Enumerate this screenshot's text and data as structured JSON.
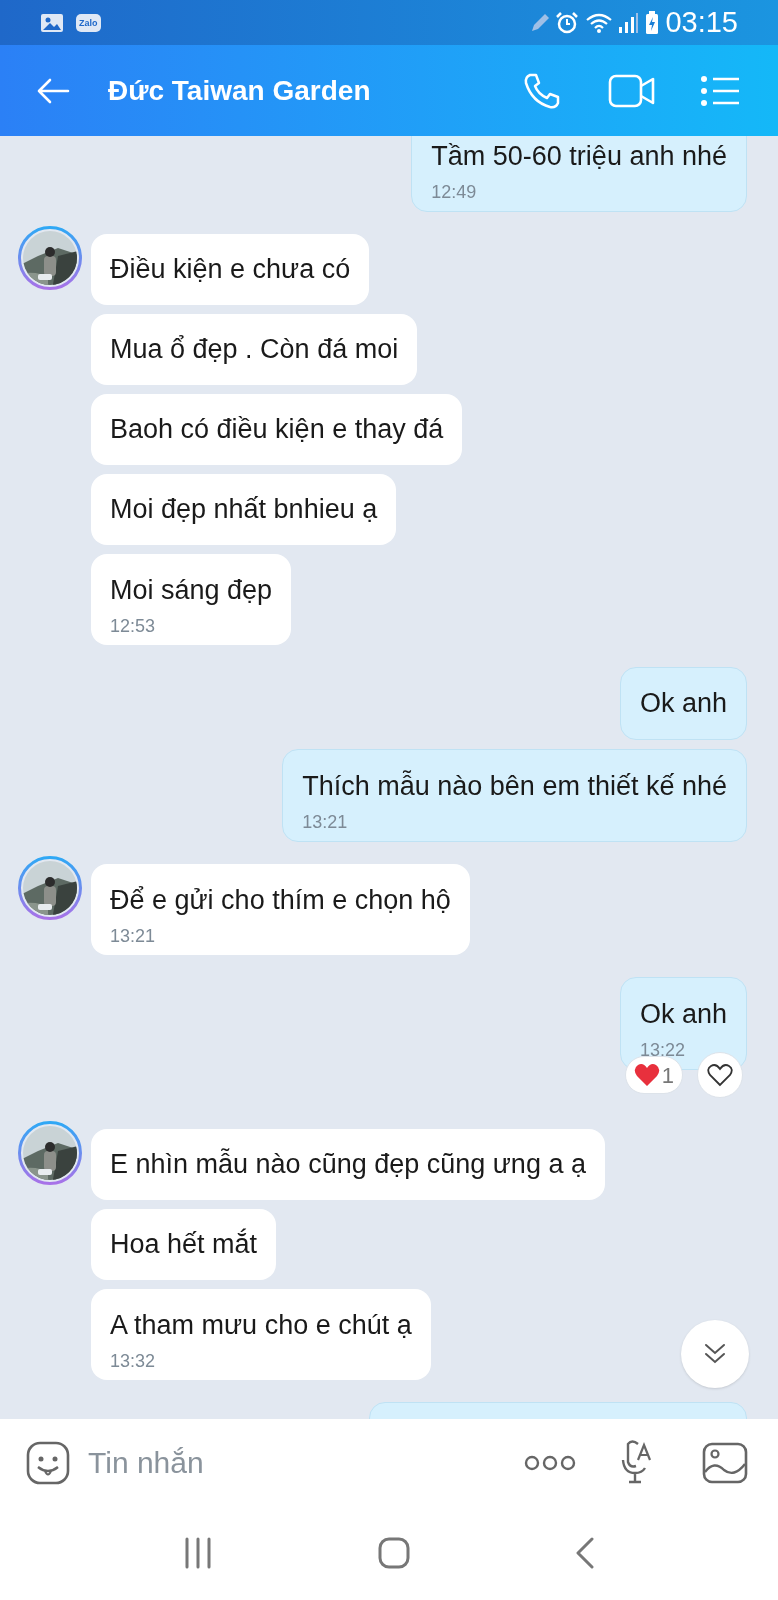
{
  "status_bar": {
    "app_badge": "Zalo",
    "time": "03:15"
  },
  "header": {
    "title": "Đức Taiwan Garden"
  },
  "messages": [
    {
      "kind": "out",
      "text": "Tầm 50-60 triệu anh nhé",
      "time": "12:49"
    },
    {
      "kind": "in",
      "avatar": true,
      "text": "Điều kiện e chưa có"
    },
    {
      "kind": "in",
      "avatar": false,
      "text": "Mua ổ đẹp . Còn đá moi"
    },
    {
      "kind": "in",
      "avatar": false,
      "text": "Baoh có điều kiện e thay đá"
    },
    {
      "kind": "in",
      "avatar": false,
      "text": "Moi đẹp nhất bnhieu ạ"
    },
    {
      "kind": "in",
      "avatar": false,
      "text": "Moi sáng đẹp",
      "time": "12:53"
    },
    {
      "kind": "out",
      "text": "Ok anh"
    },
    {
      "kind": "out",
      "text": "Thích mẫu nào bên em thiết kế nhé",
      "time": "13:21"
    },
    {
      "kind": "in",
      "avatar": true,
      "text": "Để e gửi cho thím e chọn hộ",
      "time": "13:21"
    },
    {
      "kind": "out",
      "text": "Ok anh",
      "time": "13:22",
      "reactions": {
        "count": "1"
      }
    },
    {
      "kind": "in",
      "avatar": true,
      "text": "E nhìn mẫu nào cũng đẹp cũng ưng a ạ"
    },
    {
      "kind": "in",
      "avatar": false,
      "text": "Hoa hết mắt"
    },
    {
      "kind": "in",
      "avatar": false,
      "text": "A tham mưu cho e chút ạ",
      "time": "13:32"
    },
    {
      "kind": "out"
    }
  ],
  "composer": {
    "placeholder": "Tin nhắn"
  }
}
